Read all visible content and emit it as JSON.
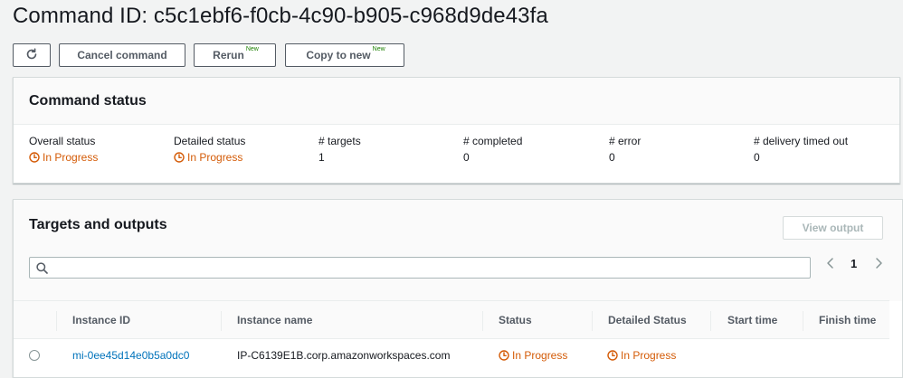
{
  "page": {
    "title": "Command ID: c5c1ebf6-f0cb-4c90-b905-c968d9de43fa"
  },
  "toolbar": {
    "refresh_icon": "refresh-icon",
    "cancel_label": "Cancel command",
    "rerun_label": "Rerun",
    "rerun_badge": "New",
    "copy_label": "Copy to new",
    "copy_badge": "New"
  },
  "status_panel": {
    "title": "Command status",
    "overall": {
      "label": "Overall status",
      "value": "In Progress"
    },
    "detailed": {
      "label": "Detailed status",
      "value": "In Progress"
    },
    "targets": {
      "label": "# targets",
      "value": "1"
    },
    "completed": {
      "label": "# completed",
      "value": "0"
    },
    "error": {
      "label": "# error",
      "value": "0"
    },
    "timed_out": {
      "label": "# delivery timed out",
      "value": "0"
    }
  },
  "targets_panel": {
    "title": "Targets and outputs",
    "view_output_label": "View output",
    "search": {
      "value": "",
      "placeholder": ""
    },
    "pagination": {
      "prev": "‹",
      "current": "1",
      "next": "›"
    },
    "columns": [
      "Instance ID",
      "Instance name",
      "Status",
      "Detailed Status",
      "Start time",
      "Finish time"
    ],
    "rows": [
      {
        "instance_id": "mi-0ee45d14e0b5a0dc0",
        "instance_name": "IP-C6139E1B.corp.amazonworkspaces.com",
        "status": "In Progress",
        "detailed_status": "In Progress",
        "start_time": "",
        "finish_time": ""
      }
    ]
  },
  "colors": {
    "in_progress": "#d45b07",
    "link": "#0073bb",
    "new_badge": "#1d8102"
  }
}
